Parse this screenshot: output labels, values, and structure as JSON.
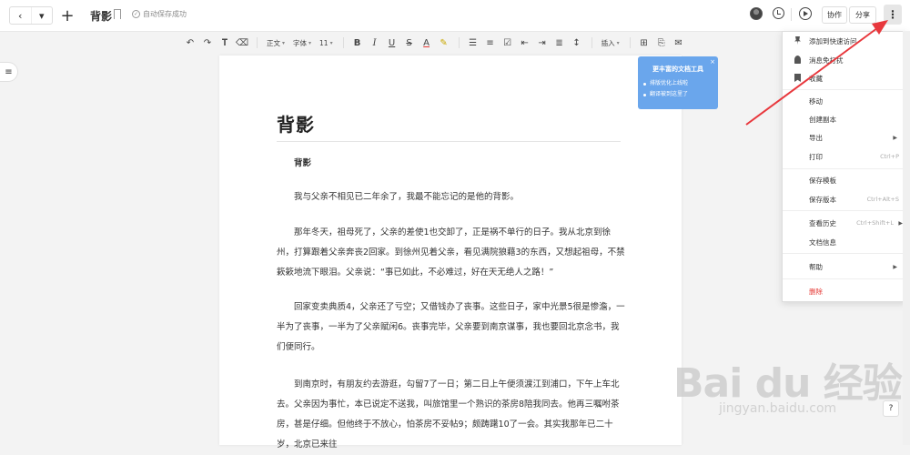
{
  "header": {
    "doc_title": "背影",
    "save_status": "自动保存成功",
    "collab_label": "协作",
    "share_label": "分享",
    "more_label": "⋮"
  },
  "toolbar": {
    "style_select": "正文",
    "font_select": "字体",
    "size_select": "11",
    "insert_label": "插入"
  },
  "document": {
    "title": "背影",
    "paragraphs": [
      {
        "text": "背影",
        "bold": true
      },
      {
        "text": "我与父亲不相见已二年余了，我最不能忘记的是他的背影。"
      },
      {
        "text": "那年冬天，祖母死了，父亲的差使1也交卸了，正是祸不单行的日子。我从北京到徐州，打算跟着父亲奔丧2回家。到徐州见着父亲，看见满院狼藉3的东西，又想起祖母，不禁簌簌地流下眼泪。父亲说：“事已如此，不必难过，好在天无绝人之路！”"
      },
      {
        "text": "回家变卖典质4，父亲还了亏空；又借钱办了丧事。这些日子，家中光景5很是惨澹，一半为了丧事，一半为了父亲赋闲6。丧事完毕，父亲要到南京谋事，我也要回北京念书，我们便同行。"
      },
      {
        "text": "到南京时，有朋友约去游逛，勾留7了一日；第二日上午便须渡江到浦口，下午上车北去。父亲因为事忙，本已说定不送我，叫旅馆里一个熟识的茶房8陪我同去。他再三嘱咐茶房，甚是仔细。但他终于不放心，怕茶房不妥帖9；颇踌躇10了一会。其实我那年已二十岁，北京已来往"
      }
    ]
  },
  "tip_card": {
    "title": "更丰富的文档工具",
    "items": [
      "排版优化上线啦",
      "翻译被到这里了"
    ],
    "close": "×"
  },
  "menu": {
    "items": [
      {
        "label": "添加到快速访问",
        "icon": "pin-icon"
      },
      {
        "label": "消息免打扰",
        "icon": "bell-mute-icon"
      },
      {
        "label": "收藏",
        "icon": "bookmark-icon"
      },
      {
        "label": "移动"
      },
      {
        "label": "创建副本"
      },
      {
        "label": "导出",
        "submenu": true
      },
      {
        "label": "打印",
        "shortcut": "Ctrl+P"
      },
      {
        "label": "保存模板"
      },
      {
        "label": "保存版本",
        "shortcut": "Ctrl+Alt+S"
      },
      {
        "label": "查看历史",
        "shortcut": "Ctrl+Shift+L",
        "submenu": true
      },
      {
        "label": "文档信息"
      },
      {
        "label": "帮助",
        "submenu": true
      },
      {
        "label": "删除",
        "danger": true
      }
    ]
  },
  "watermark": {
    "text": "Bai du 经验",
    "sub": "jingyan.baidu.com"
  },
  "help_label": "?",
  "colors": {
    "accent_blue": "#6aa6ec",
    "danger_red": "#e53935",
    "annotation_arrow": "#e8383d"
  }
}
